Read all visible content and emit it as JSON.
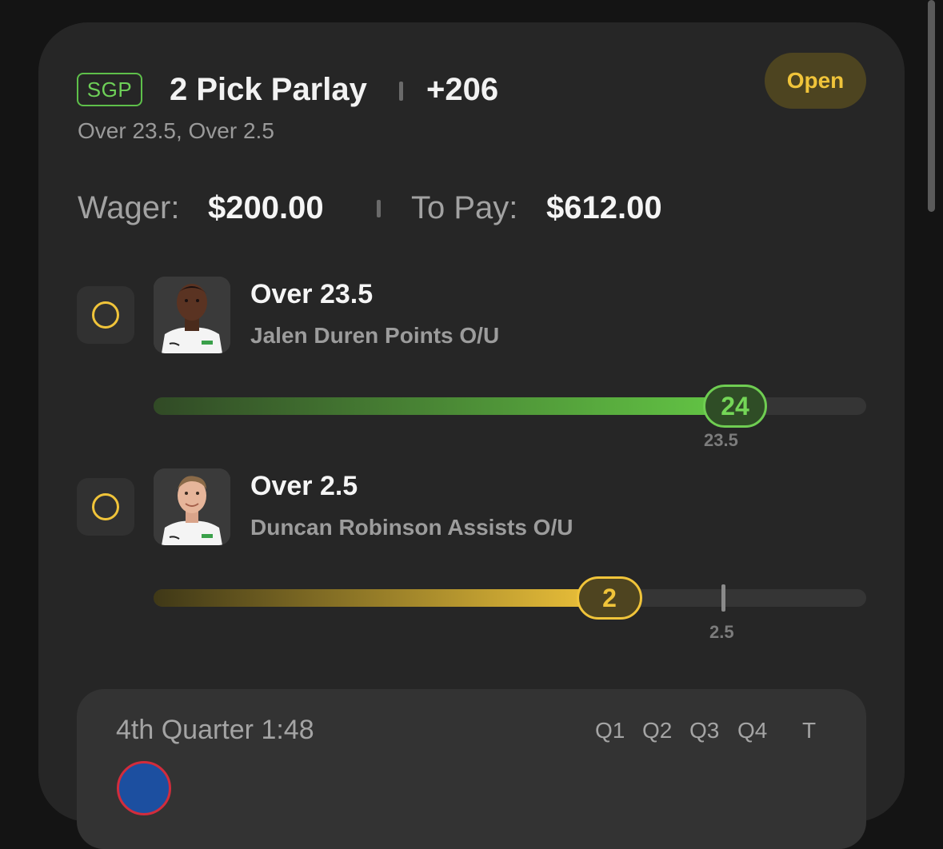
{
  "bet": {
    "badge": "SGP",
    "title": "2 Pick Parlay",
    "odds": "+206",
    "subtitle": "Over 23.5, Over 2.5",
    "status": "Open"
  },
  "wager": {
    "wager_label": "Wager:",
    "wager_value": "$200.00",
    "pay_label": "To Pay:",
    "pay_value": "$612.00"
  },
  "picks": [
    {
      "title": "Over 23.5",
      "market": "Jalen Duren Points O/U",
      "current": "24",
      "line": "23.5",
      "progress_fraction": 0.8,
      "status_color": "#6ed058"
    },
    {
      "title": "Over 2.5",
      "market": "Duncan Robinson Assists O/U",
      "current": "2",
      "line": "2.5",
      "progress_fraction": 0.64,
      "status_color": "#f0c43a"
    }
  ],
  "game": {
    "period": "4th Quarter",
    "clock": "1:48",
    "quarters": [
      "Q1",
      "Q2",
      "Q3",
      "Q4",
      "T"
    ]
  },
  "colors": {
    "accent_green": "#6ed058",
    "accent_yellow": "#f0c43a",
    "background": "#141414",
    "card": "#262626"
  },
  "icons": {
    "radio": "radio-unchecked-icon",
    "team": "team-logo-icon"
  }
}
